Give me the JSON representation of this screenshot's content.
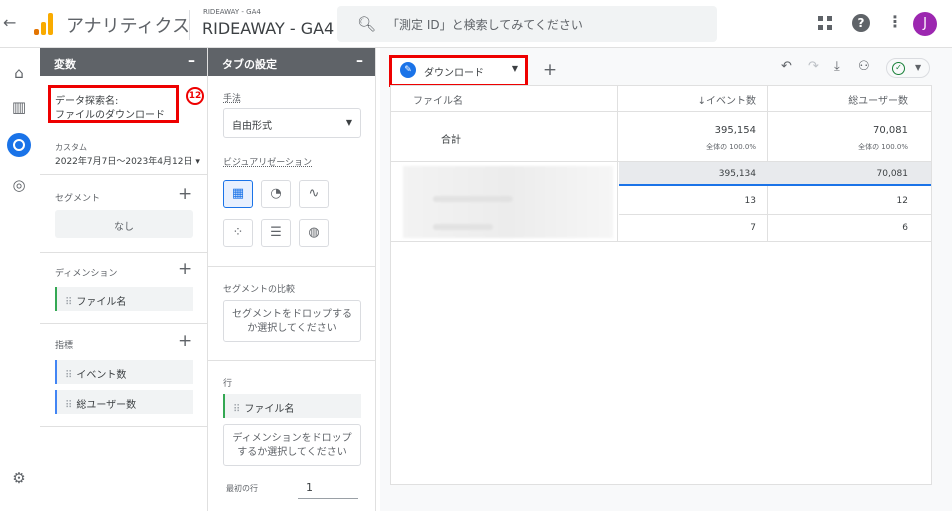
{
  "topbar": {
    "app_title": "アナリティクス",
    "property_small": "RIDEAWAY - GA4",
    "property_large": "RIDEAWAY - GA4",
    "search_placeholder": "「測定 ID」と検索してみてください",
    "avatar_letter": "J",
    "logo_colors": [
      "#e37400",
      "#f9ab00",
      "#f9ab00"
    ]
  },
  "variables": {
    "header": "変数",
    "collapse_symbol": "–",
    "exploration_name_label": "データ探索名:",
    "exploration_name": "ファイルのダウンロード",
    "badge": "12",
    "date_label": "カスタム",
    "date_range": "2022年7月7日～2023年4月12日",
    "segments_label": "セグメント",
    "segments_empty": "なし",
    "dimensions_label": "ディメンション",
    "dimensions": [
      "ファイル名"
    ],
    "metrics_label": "指標",
    "metrics": [
      "イベント数",
      "総ユーザー数"
    ]
  },
  "tab_settings": {
    "header": "タブの設定",
    "collapse_symbol": "–",
    "technique_label": "手法",
    "technique_value": "自由形式",
    "visualization_label": "ビジュアリゼーション",
    "segment_compare_label": "セグメントの比較",
    "segment_drop_text": "セグメントをドロップするか選択してください",
    "rows_label": "行",
    "rows_chip": "ファイル名",
    "dimension_drop_text": "ディメンションをドロップするか選択してください",
    "first_row_label": "最初の行",
    "first_row_value": "1"
  },
  "canvas": {
    "tab_name": "ダウンロード",
    "add_tab": "+",
    "table": {
      "headers": [
        "ファイル名",
        "↓イベント数",
        "総ユーザー数"
      ],
      "total_label": "合計",
      "total_events": "395,154",
      "total_events_pct": "全体の 100.0%",
      "total_users": "70,081",
      "total_users_pct": "全体の 100.0%",
      "rows": [
        {
          "events": "395,134",
          "users": "70,081"
        },
        {
          "events": "13",
          "users": "12"
        },
        {
          "events": "7",
          "users": "6"
        }
      ]
    },
    "accent_color": "#1a73e8",
    "highlight_color": "#ff0000"
  }
}
